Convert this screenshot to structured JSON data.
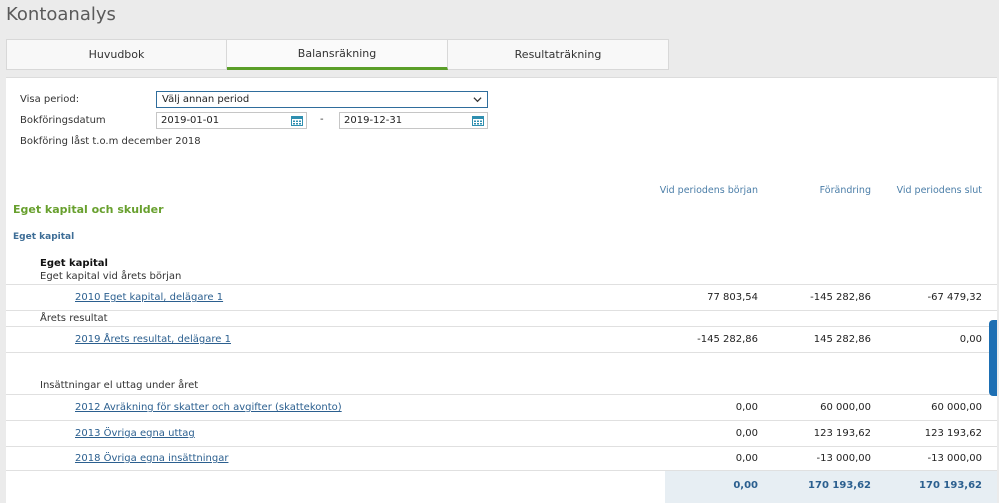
{
  "app": {
    "title": "Kontoanalys"
  },
  "tabs": [
    {
      "label": "Huvudbok",
      "active": false
    },
    {
      "label": "Balansräkning",
      "active": true
    },
    {
      "label": "Resultaträkning",
      "active": false
    }
  ],
  "filters": {
    "period_label": "Visa period:",
    "period_value": "Välj annan period",
    "date_label": "Bokföringsdatum",
    "date_from": "2019-01-01",
    "date_separator": "-",
    "date_to": "2019-12-31",
    "lock_note": "Bokföring låst t.o.m december 2018"
  },
  "columns": [
    "Vid periodens början",
    "Förändring",
    "Vid periodens slut"
  ],
  "section": {
    "title": "Eget kapital och skulder",
    "subtitle": "Eget kapital",
    "group_title": "Eget kapital",
    "subgroups": [
      {
        "label": "Eget kapital vid årets början",
        "rows": [
          {
            "account": "2010 Eget kapital, delägare 1",
            "start": "77 803,54",
            "change": "-145 282,86",
            "end": "-67 479,32"
          }
        ]
      },
      {
        "label": "Årets resultat",
        "rows": [
          {
            "account": "2019 Årets resultat, delägare 1",
            "start": "-145 282,86",
            "change": "145 282,86",
            "end": "0,00"
          }
        ]
      },
      {
        "label": "Insättningar el uttag under året",
        "rows": [
          {
            "account": "2012 Avräkning för skatter och avgifter (skattekonto)",
            "start": "0,00",
            "change": "60 000,00",
            "end": "60 000,00"
          },
          {
            "account": "2013 Övriga egna uttag",
            "start": "0,00",
            "change": "123 193,62",
            "end": "123 193,62"
          },
          {
            "account": "2018 Övriga egna insättningar",
            "start": "0,00",
            "change": "-13 000,00",
            "end": "-13 000,00"
          }
        ]
      }
    ],
    "totals": {
      "start": "0,00",
      "change": "170 193,62",
      "end": "170 193,62"
    }
  },
  "colors": {
    "accent_green": "#5a9e28",
    "link_blue": "#2b5f8f",
    "header_blue": "#4b7ea8",
    "scroll_blue": "#1d6fb3"
  },
  "icons": {
    "period_select": "chevron-down-icon",
    "date_picker": "calendar-icon"
  }
}
